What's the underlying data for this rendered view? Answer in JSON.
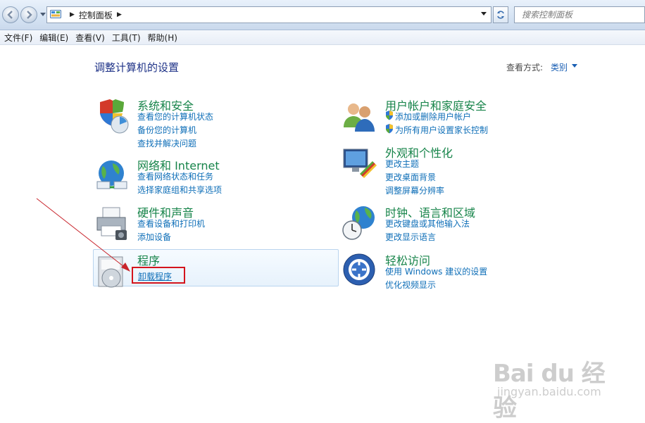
{
  "address_bar": {
    "breadcrumb": [
      "控制面板"
    ],
    "search_placeholder": "搜索控制面板"
  },
  "menu": [
    "文件(F)",
    "编辑(E)",
    "查看(V)",
    "工具(T)",
    "帮助(H)"
  ],
  "main": {
    "title": "调整计算机的设置",
    "view_by_label": "查看方式:",
    "view_by_value": "类别"
  },
  "categories": [
    {
      "title": "系统和安全",
      "icon": "shield-icon",
      "links": [
        "查看您的计算机状态",
        "备份您的计算机",
        "查找并解决问题"
      ]
    },
    {
      "title": "网络和 Internet",
      "icon": "network-globe-icon",
      "links": [
        "查看网络状态和任务",
        "选择家庭组和共享选项"
      ]
    },
    {
      "title": "硬件和声音",
      "icon": "printer-icon",
      "links": [
        "查看设备和打印机",
        "添加设备"
      ]
    },
    {
      "title": "程序",
      "icon": "programs-disc-icon",
      "links": [
        "卸载程序"
      ]
    },
    {
      "title": "用户帐户和家庭安全",
      "icon": "users-icon",
      "links": [
        "添加或删除用户帐户",
        "为所有用户设置家长控制"
      ]
    },
    {
      "title": "外观和个性化",
      "icon": "monitor-palette-icon",
      "links": [
        "更改主题",
        "更改桌面背景",
        "调整屏幕分辨率"
      ]
    },
    {
      "title": "时钟、语言和区域",
      "icon": "globe-clock-icon",
      "links": [
        "更改键盘或其他输入法",
        "更改显示语言"
      ]
    },
    {
      "title": "轻松访问",
      "icon": "ease-of-access-icon",
      "links": [
        "使用 Windows 建议的设置",
        "优化视频显示"
      ]
    }
  ],
  "watermark": {
    "logo": "Bai du 经验",
    "url": "jingyan.baidu.com"
  },
  "colors": {
    "category_title": "#17844a",
    "link": "#0f6fb8",
    "page_title": "#1e3287",
    "annotation_red": "#d4141c"
  }
}
